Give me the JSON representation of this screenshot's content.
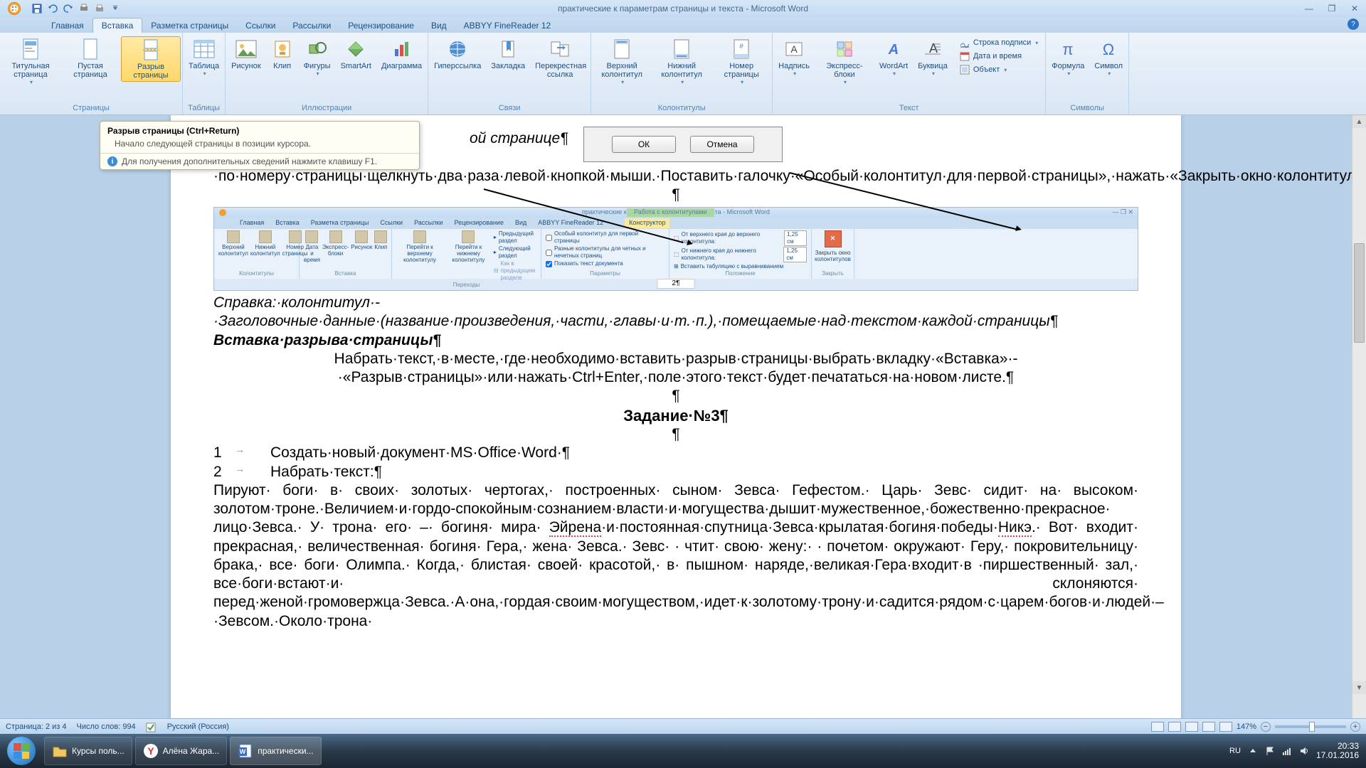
{
  "titlebar": {
    "title": "практические к параметрам страницы и текста - Microsoft Word"
  },
  "tabs": [
    "Главная",
    "Вставка",
    "Разметка страницы",
    "Ссылки",
    "Рассылки",
    "Рецензирование",
    "Вид",
    "ABBYY FineReader 12"
  ],
  "active_tab": 1,
  "ribbon": {
    "groups": {
      "pages": {
        "label": "Страницы",
        "buttons": [
          {
            "label": "Титульная страница",
            "drop": true
          },
          {
            "label": "Пустая страница"
          },
          {
            "label": "Разрыв страницы",
            "active": true
          }
        ]
      },
      "tables": {
        "label": "Таблицы",
        "buttons": [
          {
            "label": "Таблица",
            "drop": true
          }
        ]
      },
      "illustrations": {
        "label": "Иллюстрации",
        "buttons": [
          {
            "label": "Рисунок"
          },
          {
            "label": "Клип"
          },
          {
            "label": "Фигуры",
            "drop": true
          },
          {
            "label": "SmartArt"
          },
          {
            "label": "Диаграмма"
          }
        ]
      },
      "links": {
        "label": "Связи",
        "buttons": [
          {
            "label": "Гиперссылка"
          },
          {
            "label": "Закладка"
          },
          {
            "label": "Перекрестная ссылка"
          }
        ]
      },
      "headers": {
        "label": "Колонтитулы",
        "buttons": [
          {
            "label": "Верхний колонтитул",
            "drop": true
          },
          {
            "label": "Нижний колонтитул",
            "drop": true
          },
          {
            "label": "Номер страницы",
            "drop": true
          }
        ]
      },
      "text": {
        "label": "Текст",
        "buttons": [
          {
            "label": "Надпись",
            "drop": true
          },
          {
            "label": "Экспресс-блоки",
            "drop": true
          },
          {
            "label": "WordArt",
            "drop": true
          },
          {
            "label": "Буквица",
            "drop": true
          }
        ],
        "stack": [
          {
            "label": "Строка подписи",
            "drop": true
          },
          {
            "label": "Дата и время"
          },
          {
            "label": "Объект",
            "drop": true
          }
        ]
      },
      "symbols": {
        "label": "Символы",
        "buttons": [
          {
            "label": "Формула",
            "drop": true
          },
          {
            "label": "Символ",
            "drop": true
          }
        ]
      }
    }
  },
  "tooltip": {
    "title": "Разрыв страницы (Ctrl+Return)",
    "body": "Начало следующей страницы в позиции курсора.",
    "footer": "Для получения дополнительных сведений нажмите клавишу F1."
  },
  "dialog": {
    "ok": "ОК",
    "cancel": "Отмена"
  },
  "doc": {
    "p1_partial": "ой странице¶",
    "p2": "Вставить·номер·–·по·номеру·страницы·щелкнуть·два·раза·левой·кнопкой·мыши.·Поставить·галочку·«Особый·колонтитул·для·первой·страницы»,·нажать·«Закрыть·окно·колонтитулов»¶",
    "p3_empty": "¶",
    "p4_italic": "Справка:·колонтитул·-·Заголовочные·данные·(название·произведения,·части,·главы·и·т.·п.),·помещаемые·над·текстом·каждой·страницы¶",
    "p5_heading": "Вставка·разрыва·страницы¶",
    "p6": "Набрать·текст,·в·месте,·где·необходимо·вставить·разрыв·страницы·выбрать·вкладку·«Вставка»·-·«Разрыв·страницы»·или·нажать·Ctrl+Enter,·поле·этого·текст·будет·печататься·на·новом·листе.¶",
    "p7_empty": "¶",
    "p8_heading": "Задание·№3¶",
    "p9_empty": "¶",
    "list1_num": "1",
    "list1_text": "Создать·новый·документ·MS·Office·Word·¶",
    "list2_num": "2",
    "list2_text": "Набрать·текст:¶",
    "body_a": "Пируют· боги· в· своих· золотых· чертогах,· построенных· сыном· Зевса· Гефестом.· Царь· Зевс· сидит· на· высоком· золотом·троне.·Величием·и·гордо-спокойным·сознанием·власти·и·могущества·дышит·мужественное,·божественно·прекрасное· лицо·Зевса.· У· трона· его· –· богиня· мира· ",
    "body_eirena": "Эйрена",
    "body_b": "·и·постоянная·спутница·Зевса·крылатая·богиня·победы·",
    "body_nike": "Никэ",
    "body_c": ".· Вот· входит· прекрасная,· величественная· богиня· Гера,· жена· Зевса.· Зевс· · чтит· свою· жену:· · почетом· окружают· Геру,· покровительницу· брака,· все· боги· Олимпа.· Когда,· блистая· своей· красотой,· в· пышном· наряде,·великая·Гера·входит·в ·пиршественный· зал,· все·боги·встают·и· склоняются· перед·женой·громовержца·Зевса.·А·она,·гордая·своим·могуществом,·идет·к·золотому·трону·и·садится·рядом·с·царем·богов·и·людей·–·Зевсом.·Около·трона·"
  },
  "embedded": {
    "title": "практические к параметрам страницы и текста - Microsoft Word",
    "ctx": "Работа с колонтитулами",
    "ctx_tab": "Конструктор",
    "tabs": [
      "Главная",
      "Вставка",
      "Разметка страницы",
      "Ссылки",
      "Рассылки",
      "Рецензирование",
      "Вид",
      "ABBYY FineReader 12"
    ],
    "grp_hf": "Колонтитулы",
    "hf_btns": [
      "Верхний колонтитул",
      "Нижний колонтитул",
      "Номер страницы"
    ],
    "grp_ins": "Вставка",
    "ins_btns": [
      "Дата и время",
      "Экспресс-блоки",
      "Рисунок",
      "Клип"
    ],
    "grp_nav": "Переходы",
    "nav1": "Перейти к верхнему колонтитулу",
    "nav2": "Перейти к нижнему колонтитулу",
    "nav_prev": "Предыдущий раздел",
    "nav_next": "Следующий раздел",
    "nav_link": "Как в предыдущем разделе",
    "grp_opt": "Параметры",
    "opt1": "Особый колонтитул для первой страницы",
    "opt2": "Разные колонтитулы для четных и нечетных страниц",
    "opt3": "Показать текст документа",
    "grp_pos": "Положение",
    "pos1": "От верхнего края до верхнего колонтитула:",
    "pos2": "От нижнего края до нижнего колонтитула:",
    "pos_val": "1,25 см",
    "pos_tab": "Вставить табуляцию с выравниванием",
    "grp_close": "Закрыть",
    "close_btn": "Закрыть окно колонтитулов",
    "page_num": "2¶"
  },
  "statusbar": {
    "page": "Страница: 2 из 4",
    "words": "Число слов: 994",
    "lang": "Русский (Россия)",
    "zoom": "147%"
  },
  "taskbar": {
    "items": [
      {
        "label": "Курсы поль..."
      },
      {
        "label": "Алёна Жара..."
      },
      {
        "label": "практически..."
      }
    ],
    "lang": "RU",
    "time": "20:33",
    "date": "17.01.2016"
  }
}
